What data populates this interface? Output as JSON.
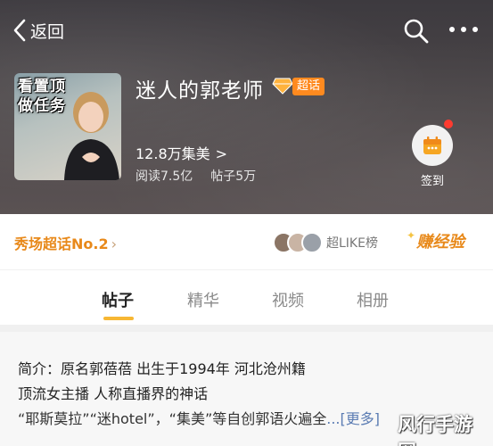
{
  "header": {
    "back_label": "返回",
    "topic_name": "迷人的郭老师",
    "badge_label": "超话",
    "fans": "12.8万集美",
    "fans_chevron": ">",
    "reads": "阅读7.5亿",
    "posts": "帖子5万",
    "signin_label": "签到",
    "cover_text": "看置顶做任务"
  },
  "rank": {
    "text": "秀场超话No.2",
    "chevron": "›",
    "like_rank": "超LIKE榜",
    "earn": "赚经验"
  },
  "tabs": [
    {
      "label": "帖子",
      "active": true
    },
    {
      "label": "精华",
      "active": false
    },
    {
      "label": "视频",
      "active": false
    },
    {
      "label": "相册",
      "active": false
    }
  ],
  "intro": {
    "line1": "简介：原名郭蓓蓓 出生于1994年 河北沧州籍",
    "line2": "顶流女主播 人称直播界的神话",
    "line3": "“耶斯莫拉”“迷hotel”，“集美”等自创郭语火遍全",
    "more": "...[更多]"
  },
  "watermark": "风行手游网",
  "colors": {
    "accent_orange": "#e8891a",
    "badge_orange": "#ff8a1f",
    "tab_underline": "#f7b733",
    "link_blue": "#5b7cb3",
    "red_dot": "#ff3b30"
  },
  "icons": [
    "back-arrow-icon",
    "search-icon",
    "more-icon",
    "diamond-icon",
    "calendar-icon",
    "spark-icon"
  ]
}
